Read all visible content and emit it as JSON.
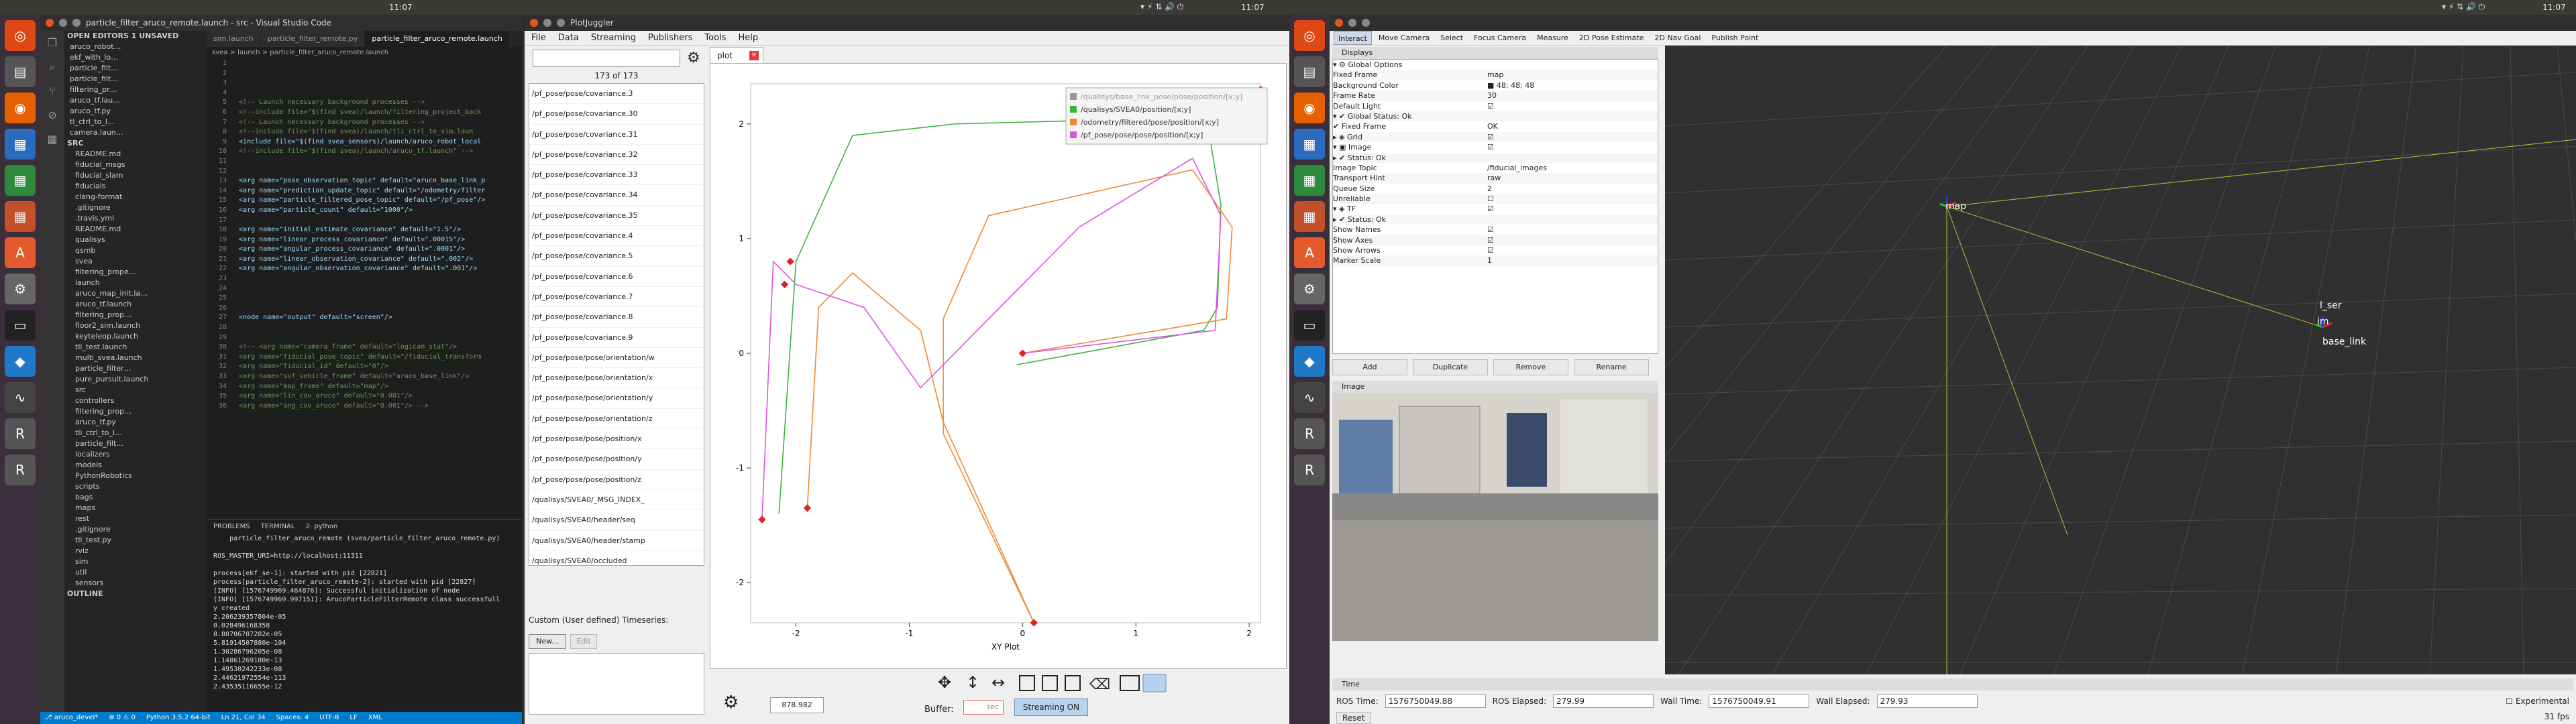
{
  "topbar": {
    "left_clock": "11:07",
    "mid_clock": "11:07",
    "right_clock": "11:07",
    "tray": "▾ ⚡ ⇅ 🔊 ⏻"
  },
  "vscode": {
    "title": "particle_filter_aruco_remote.launch - src - Visual Studio Code",
    "tabs": [
      "sim.launch",
      "particle_filter_remote.py",
      "particle_filter_aruco_remote.launch"
    ],
    "breadcrumb": "svea > launch > particle_filter_aruco_remote.launch",
    "sidebar": [
      "OPEN EDITORS  1 UNSAVED",
      "aruco_robot…",
      "ekf_with_lo…",
      "particle_filt…",
      "particle_filt…",
      "filtering_pr…",
      "aruco_tf.lau…",
      "aruco_tf.py",
      "tl_ctrl_to_l…",
      "camera.laun…",
      "SRC",
      "README.md",
      "fiducial_msgs",
      "fiducial_slam",
      "fiducials",
      "clang-format",
      ".gitignore",
      ".travis.yml",
      "README.md",
      "qualisys",
      "qsmb",
      "svea",
      "filtering_prope…",
      "launch",
      "aruco_map_init.la…",
      "aruco_tf.launch",
      "filtering_prop…",
      "floor2_sim.launch",
      "keyteleop.launch",
      "tli_test.launch",
      "multi_svea.launch",
      "particle_filter…",
      "pure_pursuit.launch",
      "src",
      "controllers",
      "filtering_prop…",
      "aruco_tf.py",
      "tli_ctrl_to_l…",
      "particle_filt…",
      "localizers",
      "models",
      "PythonRobotics",
      "scripts",
      "bags",
      "maps",
      "rest",
      ".gitignore",
      "tli_test.py",
      "rviz",
      "sim",
      "util",
      "sensors",
      "OUTLINE"
    ],
    "code": [
      [
        "  ",
        ""
      ],
      [
        "  ",
        ""
      ],
      [
        "  ",
        ""
      ],
      [
        "  ",
        ""
      ],
      [
        "com",
        "  <!-- Launch necessary background processes -->"
      ],
      [
        "com",
        "  <!--include file=\"$(find svea)/launch/filtering_project_back"
      ],
      [
        "com",
        "  <!-- Launch necessary background processes -->"
      ],
      [
        "com",
        "  <!--include file=\"$(find svea)/launch/tli_ctrl_to_sim.laun"
      ],
      [
        "tag",
        "  <include file=\"$(find svea_sensors)/launch/aruco_robot_local"
      ],
      [
        "com",
        "  <!--include file=\"$(find svea)/launch/aruco_tf.launch\" -->"
      ],
      [
        "  ",
        ""
      ],
      [
        "  ",
        ""
      ],
      [
        "tag",
        "  <arg name=\"pose_observation_topic\" default=\"aruco_base_link_p"
      ],
      [
        "tag",
        "  <arg name=\"prediction_update_topic\" default=\"/odometry/filter"
      ],
      [
        "tag",
        "  <arg name=\"particle_filtered_pose_topic\" default=\"/pf_pose\"/>"
      ],
      [
        "tag",
        "  <arg name=\"particle_count\" default=\"1000\"/>"
      ],
      [
        "  ",
        ""
      ],
      [
        "tag",
        "  <arg name=\"initial_estimate_covariance\" default=\"1.5\"/>"
      ],
      [
        "tag",
        "  <arg name=\"linear_process_covariance\" default=\".00015\"/>"
      ],
      [
        "tag",
        "  <arg name=\"angular_process_covariance\" default=\".0001\"/>"
      ],
      [
        "tag",
        "  <arg name=\"linear_observation_covariance\" default=\".002\"/>"
      ],
      [
        "tag",
        "  <arg name=\"angular_observation_covariance\" default=\".001\"/>"
      ],
      [
        "  ",
        ""
      ],
      [
        "  ",
        ""
      ],
      [
        "  ",
        ""
      ],
      [
        "  ",
        ""
      ],
      [
        "tag",
        "  <node name=\"output\" default=\"screen\"/>"
      ],
      [
        "  ",
        ""
      ],
      [
        "  ",
        ""
      ],
      [
        "com",
        "  <!-- <arg name=\"camera_frame\" default=\"logicam_stat\"/>"
      ],
      [
        "com",
        "  <arg name=\"fiducial_pose_topic\" default=\"/fiducial_transform"
      ],
      [
        "com",
        "  <arg name=\"fiducial_id\" default=\"0\"/>"
      ],
      [
        "com",
        "  <arg name=\"svf_vehicle_frame\" default=\"aruco_base_link\"/>"
      ],
      [
        "com",
        "  <arg name=\"map_frame\" default=\"map\"/>"
      ],
      [
        "com",
        "  <arg name=\"lin_cov_aruco\" default=\"0.001\"/>"
      ],
      [
        "com",
        "  <arg name=\"ang_cov_aruco\" default=\"0.001\"/> -->"
      ]
    ],
    "term_tabs": [
      "PROBLEMS",
      "TERMINAL",
      "2: python"
    ],
    "terminal": "    particle_filter_aruco_remote (svea/particle_filter_aruco_remote.py)\n\nROS_MASTER_URI=http://localhost:11311\n\nprocess[ekf_se-1]: started with pid [22821]\nprocess[particle_filter_aruco_remote-2]: started with pid [22827]\n[INFO] [1576749969.464876]: Successful initialization of node\n[INFO] [1576749969.997151]: ArucoParticleFilterRemote class successfull\ny created\n2.206239357804e-05\n0.028496168358\n8.80706787282e-05\n5.81914507880e-104\n1.30286796205e-08\n1.14861269180e-13\n1.49530242233e-08\n2.44621972554e-113\n2.43535116655e-12",
    "status": [
      "⎇ aruco_devel*",
      "⊗ 0 ⚠ 0",
      "Python 3.5.2 64-bit",
      "Ln 21, Col 34",
      "Spaces: 4",
      "UTF-8",
      "LF",
      "XML"
    ]
  },
  "plotjuggler": {
    "title": "PlotJuggler",
    "menu": [
      "File",
      "Data",
      "Streaming",
      "Publishers",
      "Tools",
      "Help"
    ],
    "count": "173 of 173",
    "list": [
      "/pf_pose/pose/covariance.3",
      "/pf_pose/pose/covariance.30",
      "/pf_pose/pose/covariance.31",
      "/pf_pose/pose/covariance.32",
      "/pf_pose/pose/covariance.33",
      "/pf_pose/pose/covariance.34",
      "/pf_pose/pose/covariance.35",
      "/pf_pose/pose/covariance.4",
      "/pf_pose/pose/covariance.5",
      "/pf_pose/pose/covariance.6",
      "/pf_pose/pose/covariance.7",
      "/pf_pose/pose/covariance.8",
      "/pf_pose/pose/covariance.9",
      "/pf_pose/pose/pose/orientation/w",
      "/pf_pose/pose/pose/orientation/x",
      "/pf_pose/pose/pose/orientation/y",
      "/pf_pose/pose/pose/orientation/z",
      "/pf_pose/pose/pose/position/x",
      "/pf_pose/pose/pose/position/y",
      "/pf_pose/pose/pose/position/z",
      "/qualisys/SVEA0/_MSG_INDEX_",
      "/qualisys/SVEA0/header/seq",
      "/qualisys/SVEA0/header/stamp",
      "/qualisys/SVEA0/occluded"
    ],
    "custom_label": "Custom (User defined) Timeseries:",
    "new": "New...",
    "edit": "Edit",
    "tab": "plot",
    "time_value": "878.982",
    "buffer_label": "Buffer:",
    "buffer_value": "sec",
    "streaming": "Streaming ON"
  },
  "chart_data": {
    "type": "line",
    "xlabel": "XY Plot",
    "xlim": [
      -2.4,
      2.1
    ],
    "ylim": [
      -2.35,
      2.35
    ],
    "xticks": [
      -2,
      -1,
      0,
      1,
      2
    ],
    "yticks": [
      -2,
      -1,
      0,
      1,
      2
    ],
    "legend": [
      "/qualisys/base_link_pose/pose/position/[x;y]",
      "/qualisys/SVEA0/position/[x;y]",
      "/odometry/filtered/pose/position/[x;y]",
      "/pf_pose/pose/pose/position/[x;y]"
    ],
    "series": [
      {
        "name": "/qualisys/SVEA0/position/[x;y]",
        "color": "#3cb43c",
        "points": [
          [
            -2.15,
            -1.4
          ],
          [
            -2.0,
            0.8
          ],
          [
            -1.5,
            1.9
          ],
          [
            -0.6,
            2.0
          ],
          [
            1.3,
            2.05
          ],
          [
            1.65,
            1.9
          ],
          [
            1.75,
            1.3
          ],
          [
            1.72,
            0.4
          ],
          [
            1.6,
            0.2
          ],
          [
            -0.05,
            -0.1
          ]
        ]
      },
      {
        "name": "/odometry/filtered/pose/position/[x;y]",
        "color": "#ee8833",
        "points": [
          [
            -1.9,
            -1.35
          ],
          [
            -1.8,
            0.4
          ],
          [
            -1.5,
            0.7
          ],
          [
            -0.9,
            0.2
          ],
          [
            -0.7,
            -0.6
          ],
          [
            0.1,
            -2.35
          ],
          [
            -0.7,
            -0.7
          ],
          [
            -0.7,
            0.3
          ],
          [
            -0.3,
            1.2
          ],
          [
            0.6,
            1.4
          ],
          [
            1.5,
            1.6
          ],
          [
            1.85,
            1.1
          ],
          [
            1.8,
            0.3
          ],
          [
            0.0,
            0.0
          ]
        ]
      },
      {
        "name": "/pf_pose/pose/pose/position/[x;y]",
        "color": "#dd55dd",
        "points": [
          [
            -2.3,
            -1.45
          ],
          [
            -2.2,
            0.8
          ],
          [
            -2.0,
            0.6
          ],
          [
            -1.4,
            0.4
          ],
          [
            -0.9,
            -0.3
          ],
          [
            -0.3,
            0.3
          ],
          [
            0.5,
            1.1
          ],
          [
            1.5,
            1.7
          ],
          [
            1.75,
            1.2
          ],
          [
            1.7,
            0.2
          ],
          [
            0.0,
            0.0
          ]
        ]
      }
    ],
    "markers": [
      [
        -2.3,
        -1.45
      ],
      [
        -1.9,
        -1.35
      ],
      [
        0.1,
        -2.35
      ],
      [
        0.0,
        0.0
      ],
      [
        -2.05,
        0.8
      ],
      [
        -2.1,
        0.6
      ],
      [
        2.1,
        2.3
      ]
    ]
  },
  "rviz": {
    "tools": [
      "Interact",
      "Move Camera",
      "Select",
      "Focus Camera",
      "Measure",
      "2D Pose Estimate",
      "2D Nav Goal",
      "Publish Point"
    ],
    "displays_title": "Displays",
    "tree": [
      [
        "▾ ⚙ Global Options",
        ""
      ],
      [
        "    Fixed Frame",
        "map"
      ],
      [
        "    Background Color",
        "■ 48; 48; 48"
      ],
      [
        "    Frame Rate",
        "30"
      ],
      [
        "    Default Light",
        "☑"
      ],
      [
        "▾ ✔ Global Status: Ok",
        ""
      ],
      [
        "    ✔ Fixed Frame",
        "OK"
      ],
      [
        "▸ ◈ Grid",
        "☑"
      ],
      [
        "▾ ▣ Image",
        "☑"
      ],
      [
        "  ▸ ✔ Status: Ok",
        ""
      ],
      [
        "    Image Topic",
        "/fiducial_images"
      ],
      [
        "    Transport Hint",
        "raw"
      ],
      [
        "    Queue Size",
        "2"
      ],
      [
        "    Unreliable",
        "☐"
      ],
      [
        "▾ ◈ TF",
        "☑"
      ],
      [
        "  ▸ ✔ Status: Ok",
        ""
      ],
      [
        "    Show Names",
        "☑"
      ],
      [
        "    Show Axes",
        "☑"
      ],
      [
        "    Show Arrows",
        "☑"
      ],
      [
        "    Marker Scale",
        "1"
      ]
    ],
    "buttons": [
      "Add",
      "Duplicate",
      "Remove",
      "Rename"
    ],
    "image_title": "Image",
    "frames": [
      "l_ser",
      "im",
      "base_link",
      "map"
    ],
    "time_title": "Time",
    "time": {
      "ros_time_label": "ROS Time:",
      "ros_time": "1576750049.88",
      "ros_elapsed_label": "ROS Elapsed:",
      "ros_elapsed": "279.99",
      "wall_time_label": "Wall Time:",
      "wall_time": "1576750049.91",
      "wall_elapsed_label": "Wall Elapsed:",
      "wall_elapsed": "279.93",
      "experimental": "Experimental",
      "reset": "Reset",
      "fps": "31 fps"
    }
  }
}
